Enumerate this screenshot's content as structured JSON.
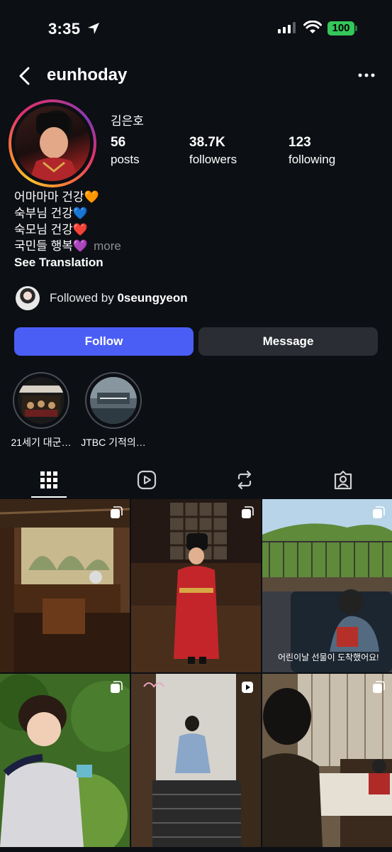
{
  "status_bar": {
    "time": "3:35",
    "battery": "100"
  },
  "header": {
    "username": "eunhoday"
  },
  "profile": {
    "full_name": "김은호",
    "stats": [
      {
        "value": "56",
        "label": "posts"
      },
      {
        "value": "38.7K",
        "label": "followers"
      },
      {
        "value": "123",
        "label": "following"
      }
    ],
    "bio_lines": [
      "어마마마 건강🧡",
      "숙부님 건강💙",
      "숙모님 건강❤️",
      "국민들 행복💜"
    ],
    "bio_more": "more",
    "see_translation": "See Translation",
    "followed_by_prefix": "Followed by ",
    "followed_by_user": "0seungyeon"
  },
  "actions": {
    "follow": "Follow",
    "message": "Message"
  },
  "highlights": [
    {
      "label": "21세기 대군…"
    },
    {
      "label": "JTBC 기적의…"
    }
  ],
  "tabs": [
    "grid-icon",
    "reels-icon",
    "reposts-icon",
    "tagged-icon"
  ],
  "grid": [
    {
      "type": "carousel",
      "alt": "palace hall"
    },
    {
      "type": "carousel",
      "alt": "boy in red royal robe"
    },
    {
      "type": "carousel",
      "alt": "boy on sofa",
      "caption": "어린이날 선물이 도착했어요!"
    },
    {
      "type": "carousel",
      "alt": "boy in garden"
    },
    {
      "type": "reel",
      "alt": "boy on stairs"
    },
    {
      "type": "carousel",
      "alt": "boy in hanbok interior"
    }
  ],
  "colors": {
    "follow_button": "#4a5ef6",
    "message_button": "#2a2d33",
    "background": "#0c0f14",
    "battery": "#34c759"
  }
}
